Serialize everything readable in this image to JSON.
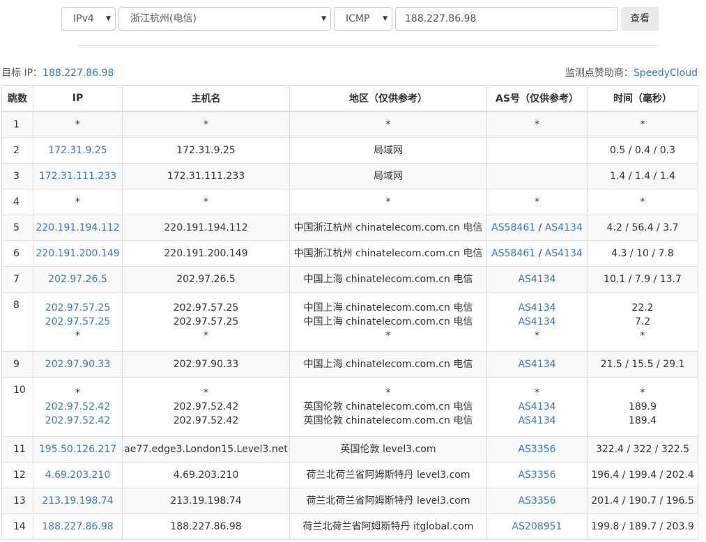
{
  "query": {
    "ip_version": "IPv4",
    "node": "浙江杭州(电信)",
    "protocol": "ICMP",
    "target": "188.227.86.98",
    "submit_label": "查看"
  },
  "info": {
    "target_label": "目标 IP：",
    "target_ip": "188.227.86.98",
    "sponsor_label": "监测点赞助商：",
    "sponsor": "SpeedyCloud"
  },
  "table": {
    "headers": [
      "跳数",
      "IP",
      "主机名",
      "地区（仅供参考）",
      "AS号（仅供参考）",
      "时间（毫秒）"
    ],
    "rows": [
      {
        "hop": "1",
        "lines": [
          {
            "ip": "*",
            "host": "*",
            "region": "*",
            "as": [],
            "as_text": "*",
            "time": "*"
          }
        ]
      },
      {
        "hop": "2",
        "lines": [
          {
            "ip": "172.31.9.25",
            "host": "172.31.9.25",
            "region": "局域网",
            "as": [],
            "time": "0.5 / 0.4 / 0.3"
          }
        ]
      },
      {
        "hop": "3",
        "lines": [
          {
            "ip": "172.31.111.233",
            "host": "172.31.111.233",
            "region": "局域网",
            "as": [],
            "time": "1.4 / 1.4 / 1.4"
          }
        ]
      },
      {
        "hop": "4",
        "lines": [
          {
            "ip": "*",
            "host": "*",
            "region": "*",
            "as": [],
            "as_text": "*",
            "time": "*"
          }
        ]
      },
      {
        "hop": "5",
        "lines": [
          {
            "ip": "220.191.194.112",
            "host": "220.191.194.112",
            "region": "中国浙江杭州 chinatelecom.com.cn 电信",
            "as": [
              "AS58461",
              "AS4134"
            ],
            "time": "4.2 / 56.4 / 3.7"
          }
        ]
      },
      {
        "hop": "6",
        "lines": [
          {
            "ip": "220.191.200.149",
            "host": "220.191.200.149",
            "region": "中国浙江杭州 chinatelecom.com.cn 电信",
            "as": [
              "AS58461",
              "AS4134"
            ],
            "time": "4.3 / 10 / 7.8"
          }
        ]
      },
      {
        "hop": "7",
        "lines": [
          {
            "ip": "202.97.26.5",
            "host": "202.97.26.5",
            "region": "中国上海 chinatelecom.com.cn 电信",
            "as": [
              "AS4134"
            ],
            "time": "10.1 / 7.9 / 13.7"
          }
        ]
      },
      {
        "hop": "8",
        "lines": [
          {
            "ip": "202.97.57.25",
            "host": "202.97.57.25",
            "region": "中国上海 chinatelecom.com.cn 电信",
            "as": [
              "AS4134"
            ],
            "time": "22.2"
          },
          {
            "ip": "202.97.57.25",
            "host": "202.97.57.25",
            "region": "中国上海 chinatelecom.com.cn 电信",
            "as": [
              "AS4134"
            ],
            "time": "7.2"
          },
          {
            "ip": "*",
            "host": "*",
            "region": "*",
            "as": [],
            "as_text": "*",
            "time": "*"
          }
        ]
      },
      {
        "hop": "9",
        "lines": [
          {
            "ip": "202.97.90.33",
            "host": "202.97.90.33",
            "region": "中国上海 chinatelecom.com.cn 电信",
            "as": [
              "AS4134"
            ],
            "time": "21.5 / 15.5 / 29.1"
          }
        ]
      },
      {
        "hop": "10",
        "lines": [
          {
            "ip": "*",
            "host": "*",
            "region": "*",
            "as": [],
            "as_text": "*",
            "time": "*"
          },
          {
            "ip": "202.97.52.42",
            "host": "202.97.52.42",
            "region": "英国伦敦 chinatelecom.com.cn 电信",
            "as": [
              "AS4134"
            ],
            "time": "189.9"
          },
          {
            "ip": "202.97.52.42",
            "host": "202.97.52.42",
            "region": "英国伦敦 chinatelecom.com.cn 电信",
            "as": [
              "AS4134"
            ],
            "time": "189.4"
          }
        ]
      },
      {
        "hop": "11",
        "lines": [
          {
            "ip": "195.50.126.217",
            "host": "ae77.edge3.London15.Level3.net",
            "region": "英国伦敦 level3.com",
            "as": [
              "AS3356"
            ],
            "time": "322.4 / 322 / 322.5"
          }
        ]
      },
      {
        "hop": "12",
        "lines": [
          {
            "ip": "4.69.203.210",
            "host": "4.69.203.210",
            "region": "荷兰北荷兰省阿姆斯特丹 level3.com",
            "as": [
              "AS3356"
            ],
            "time": "196.4 / 199.4 / 202.4"
          }
        ]
      },
      {
        "hop": "13",
        "lines": [
          {
            "ip": "213.19.198.74",
            "host": "213.19.198.74",
            "region": "荷兰北荷兰省阿姆斯特丹 level3.com",
            "as": [
              "AS3356"
            ],
            "time": "201.4 / 190.7 / 196.5"
          }
        ]
      },
      {
        "hop": "14",
        "lines": [
          {
            "ip": "188.227.86.98",
            "host": "188.227.86.98",
            "region": "荷兰北荷兰省阿姆斯特丹 itglobal.com",
            "as": [
              "AS208951"
            ],
            "time": "199.8 / 189.7 / 203.9"
          }
        ]
      }
    ]
  },
  "colors": {
    "link": "#337ab7",
    "stripe": "#f9f9f9",
    "border": "#dddddd"
  }
}
